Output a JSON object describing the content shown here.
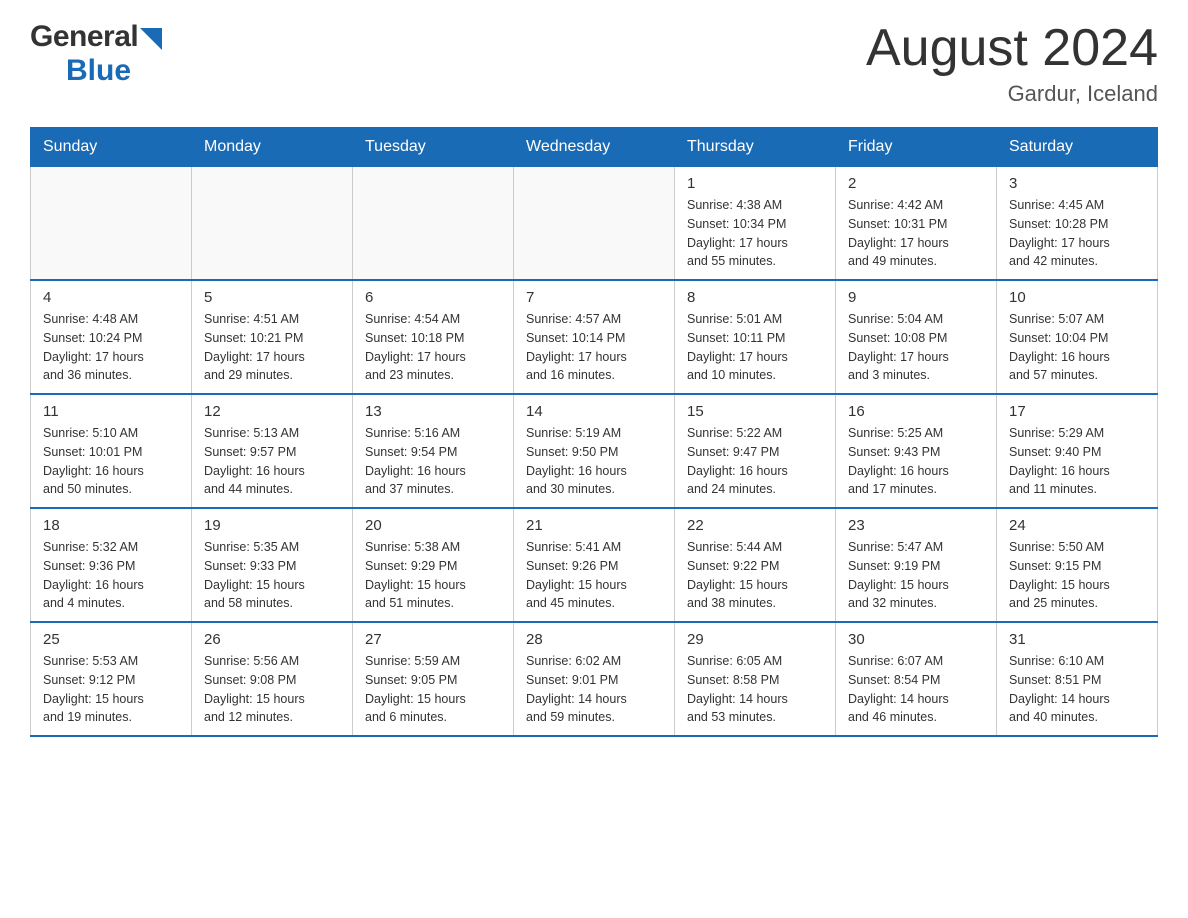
{
  "header": {
    "title": "August 2024",
    "location": "Gardur, Iceland",
    "logo_general": "General",
    "logo_blue": "Blue"
  },
  "days_of_week": [
    "Sunday",
    "Monday",
    "Tuesday",
    "Wednesday",
    "Thursday",
    "Friday",
    "Saturday"
  ],
  "weeks": [
    {
      "cells": [
        {
          "day": "",
          "info": ""
        },
        {
          "day": "",
          "info": ""
        },
        {
          "day": "",
          "info": ""
        },
        {
          "day": "",
          "info": ""
        },
        {
          "day": "1",
          "info": "Sunrise: 4:38 AM\nSunset: 10:34 PM\nDaylight: 17 hours\nand 55 minutes."
        },
        {
          "day": "2",
          "info": "Sunrise: 4:42 AM\nSunset: 10:31 PM\nDaylight: 17 hours\nand 49 minutes."
        },
        {
          "day": "3",
          "info": "Sunrise: 4:45 AM\nSunset: 10:28 PM\nDaylight: 17 hours\nand 42 minutes."
        }
      ]
    },
    {
      "cells": [
        {
          "day": "4",
          "info": "Sunrise: 4:48 AM\nSunset: 10:24 PM\nDaylight: 17 hours\nand 36 minutes."
        },
        {
          "day": "5",
          "info": "Sunrise: 4:51 AM\nSunset: 10:21 PM\nDaylight: 17 hours\nand 29 minutes."
        },
        {
          "day": "6",
          "info": "Sunrise: 4:54 AM\nSunset: 10:18 PM\nDaylight: 17 hours\nand 23 minutes."
        },
        {
          "day": "7",
          "info": "Sunrise: 4:57 AM\nSunset: 10:14 PM\nDaylight: 17 hours\nand 16 minutes."
        },
        {
          "day": "8",
          "info": "Sunrise: 5:01 AM\nSunset: 10:11 PM\nDaylight: 17 hours\nand 10 minutes."
        },
        {
          "day": "9",
          "info": "Sunrise: 5:04 AM\nSunset: 10:08 PM\nDaylight: 17 hours\nand 3 minutes."
        },
        {
          "day": "10",
          "info": "Sunrise: 5:07 AM\nSunset: 10:04 PM\nDaylight: 16 hours\nand 57 minutes."
        }
      ]
    },
    {
      "cells": [
        {
          "day": "11",
          "info": "Sunrise: 5:10 AM\nSunset: 10:01 PM\nDaylight: 16 hours\nand 50 minutes."
        },
        {
          "day": "12",
          "info": "Sunrise: 5:13 AM\nSunset: 9:57 PM\nDaylight: 16 hours\nand 44 minutes."
        },
        {
          "day": "13",
          "info": "Sunrise: 5:16 AM\nSunset: 9:54 PM\nDaylight: 16 hours\nand 37 minutes."
        },
        {
          "day": "14",
          "info": "Sunrise: 5:19 AM\nSunset: 9:50 PM\nDaylight: 16 hours\nand 30 minutes."
        },
        {
          "day": "15",
          "info": "Sunrise: 5:22 AM\nSunset: 9:47 PM\nDaylight: 16 hours\nand 24 minutes."
        },
        {
          "day": "16",
          "info": "Sunrise: 5:25 AM\nSunset: 9:43 PM\nDaylight: 16 hours\nand 17 minutes."
        },
        {
          "day": "17",
          "info": "Sunrise: 5:29 AM\nSunset: 9:40 PM\nDaylight: 16 hours\nand 11 minutes."
        }
      ]
    },
    {
      "cells": [
        {
          "day": "18",
          "info": "Sunrise: 5:32 AM\nSunset: 9:36 PM\nDaylight: 16 hours\nand 4 minutes."
        },
        {
          "day": "19",
          "info": "Sunrise: 5:35 AM\nSunset: 9:33 PM\nDaylight: 15 hours\nand 58 minutes."
        },
        {
          "day": "20",
          "info": "Sunrise: 5:38 AM\nSunset: 9:29 PM\nDaylight: 15 hours\nand 51 minutes."
        },
        {
          "day": "21",
          "info": "Sunrise: 5:41 AM\nSunset: 9:26 PM\nDaylight: 15 hours\nand 45 minutes."
        },
        {
          "day": "22",
          "info": "Sunrise: 5:44 AM\nSunset: 9:22 PM\nDaylight: 15 hours\nand 38 minutes."
        },
        {
          "day": "23",
          "info": "Sunrise: 5:47 AM\nSunset: 9:19 PM\nDaylight: 15 hours\nand 32 minutes."
        },
        {
          "day": "24",
          "info": "Sunrise: 5:50 AM\nSunset: 9:15 PM\nDaylight: 15 hours\nand 25 minutes."
        }
      ]
    },
    {
      "cells": [
        {
          "day": "25",
          "info": "Sunrise: 5:53 AM\nSunset: 9:12 PM\nDaylight: 15 hours\nand 19 minutes."
        },
        {
          "day": "26",
          "info": "Sunrise: 5:56 AM\nSunset: 9:08 PM\nDaylight: 15 hours\nand 12 minutes."
        },
        {
          "day": "27",
          "info": "Sunrise: 5:59 AM\nSunset: 9:05 PM\nDaylight: 15 hours\nand 6 minutes."
        },
        {
          "day": "28",
          "info": "Sunrise: 6:02 AM\nSunset: 9:01 PM\nDaylight: 14 hours\nand 59 minutes."
        },
        {
          "day": "29",
          "info": "Sunrise: 6:05 AM\nSunset: 8:58 PM\nDaylight: 14 hours\nand 53 minutes."
        },
        {
          "day": "30",
          "info": "Sunrise: 6:07 AM\nSunset: 8:54 PM\nDaylight: 14 hours\nand 46 minutes."
        },
        {
          "day": "31",
          "info": "Sunrise: 6:10 AM\nSunset: 8:51 PM\nDaylight: 14 hours\nand 40 minutes."
        }
      ]
    }
  ]
}
